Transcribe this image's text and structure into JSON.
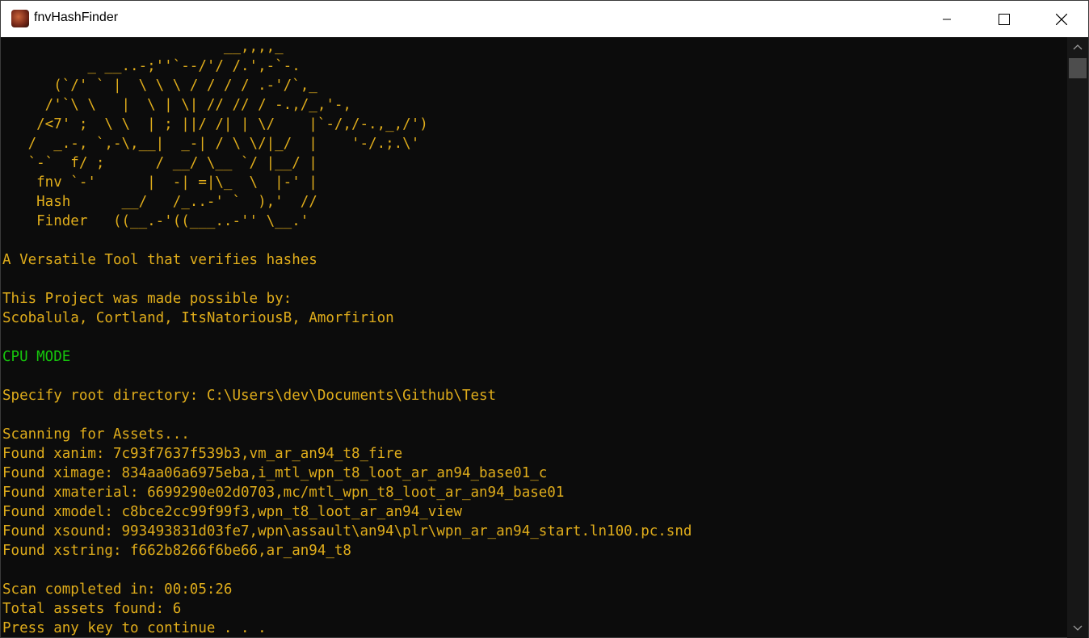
{
  "window": {
    "title": "fnvHashFinder",
    "icon": "app-icon"
  },
  "console": {
    "ascii_art": [
      "                          __,,,,_",
      "          _ __..-;''`--/'/ /.',-`-.",
      "      (`/' ` |  \\ \\ \\ / / / / .-'/`,_",
      "     /'`\\ \\   |  \\ | \\| // // / -.,/_,'-,",
      "    /<7' ;  \\ \\  | ; ||/ /| | \\/    |`-/,/-.,_,/')",
      "   /  _.-, `,-\\,__|  _-| / \\ \\/|_/  |    '-/.;.\\'",
      "   `-`  f/ ;      / __/ \\__ `/ |__/ |",
      "    fnv `-'      |  -| =|\\_  \\  |-' |",
      "    Hash      __/   /_..-' `  ),'  //",
      "    Finder   ((__.-'((___..-'' \\__.'"
    ],
    "tagline": "A Versatile Tool that verifies hashes",
    "credits_heading": "This Project was made possible by:",
    "credits_names": "Scobalula, Cortland, ItsNatoriousB, Amorfirion",
    "mode": "CPU MODE",
    "root_prompt": "Specify root directory: C:\\Users\\dev\\Documents\\Github\\Test",
    "scanning": "Scanning for Assets...",
    "found": [
      "Found xanim: 7c93f7637f539b3,vm_ar_an94_t8_fire",
      "Found ximage: 834aa06a6975eba,i_mtl_wpn_t8_loot_ar_an94_base01_c",
      "Found xmaterial: 6699290e02d0703,mc/mtl_wpn_t8_loot_ar_an94_base01",
      "Found xmodel: c8bce2cc99f99f3,wpn_t8_loot_ar_an94_view",
      "Found xsound: 993493831d03fe7,wpn\\assault\\an94\\plr\\wpn_ar_an94_start.ln100.pc.snd",
      "Found xstring: f662b8266f6be66,ar_an94_t8"
    ],
    "completed": "Scan completed in: 00:05:26",
    "total": "Total assets found: 6",
    "press_key": "Press any key to continue . . ."
  },
  "colors": {
    "text": "#e0ad1b",
    "mode": "#16c60c",
    "background": "#0c0c0c"
  }
}
